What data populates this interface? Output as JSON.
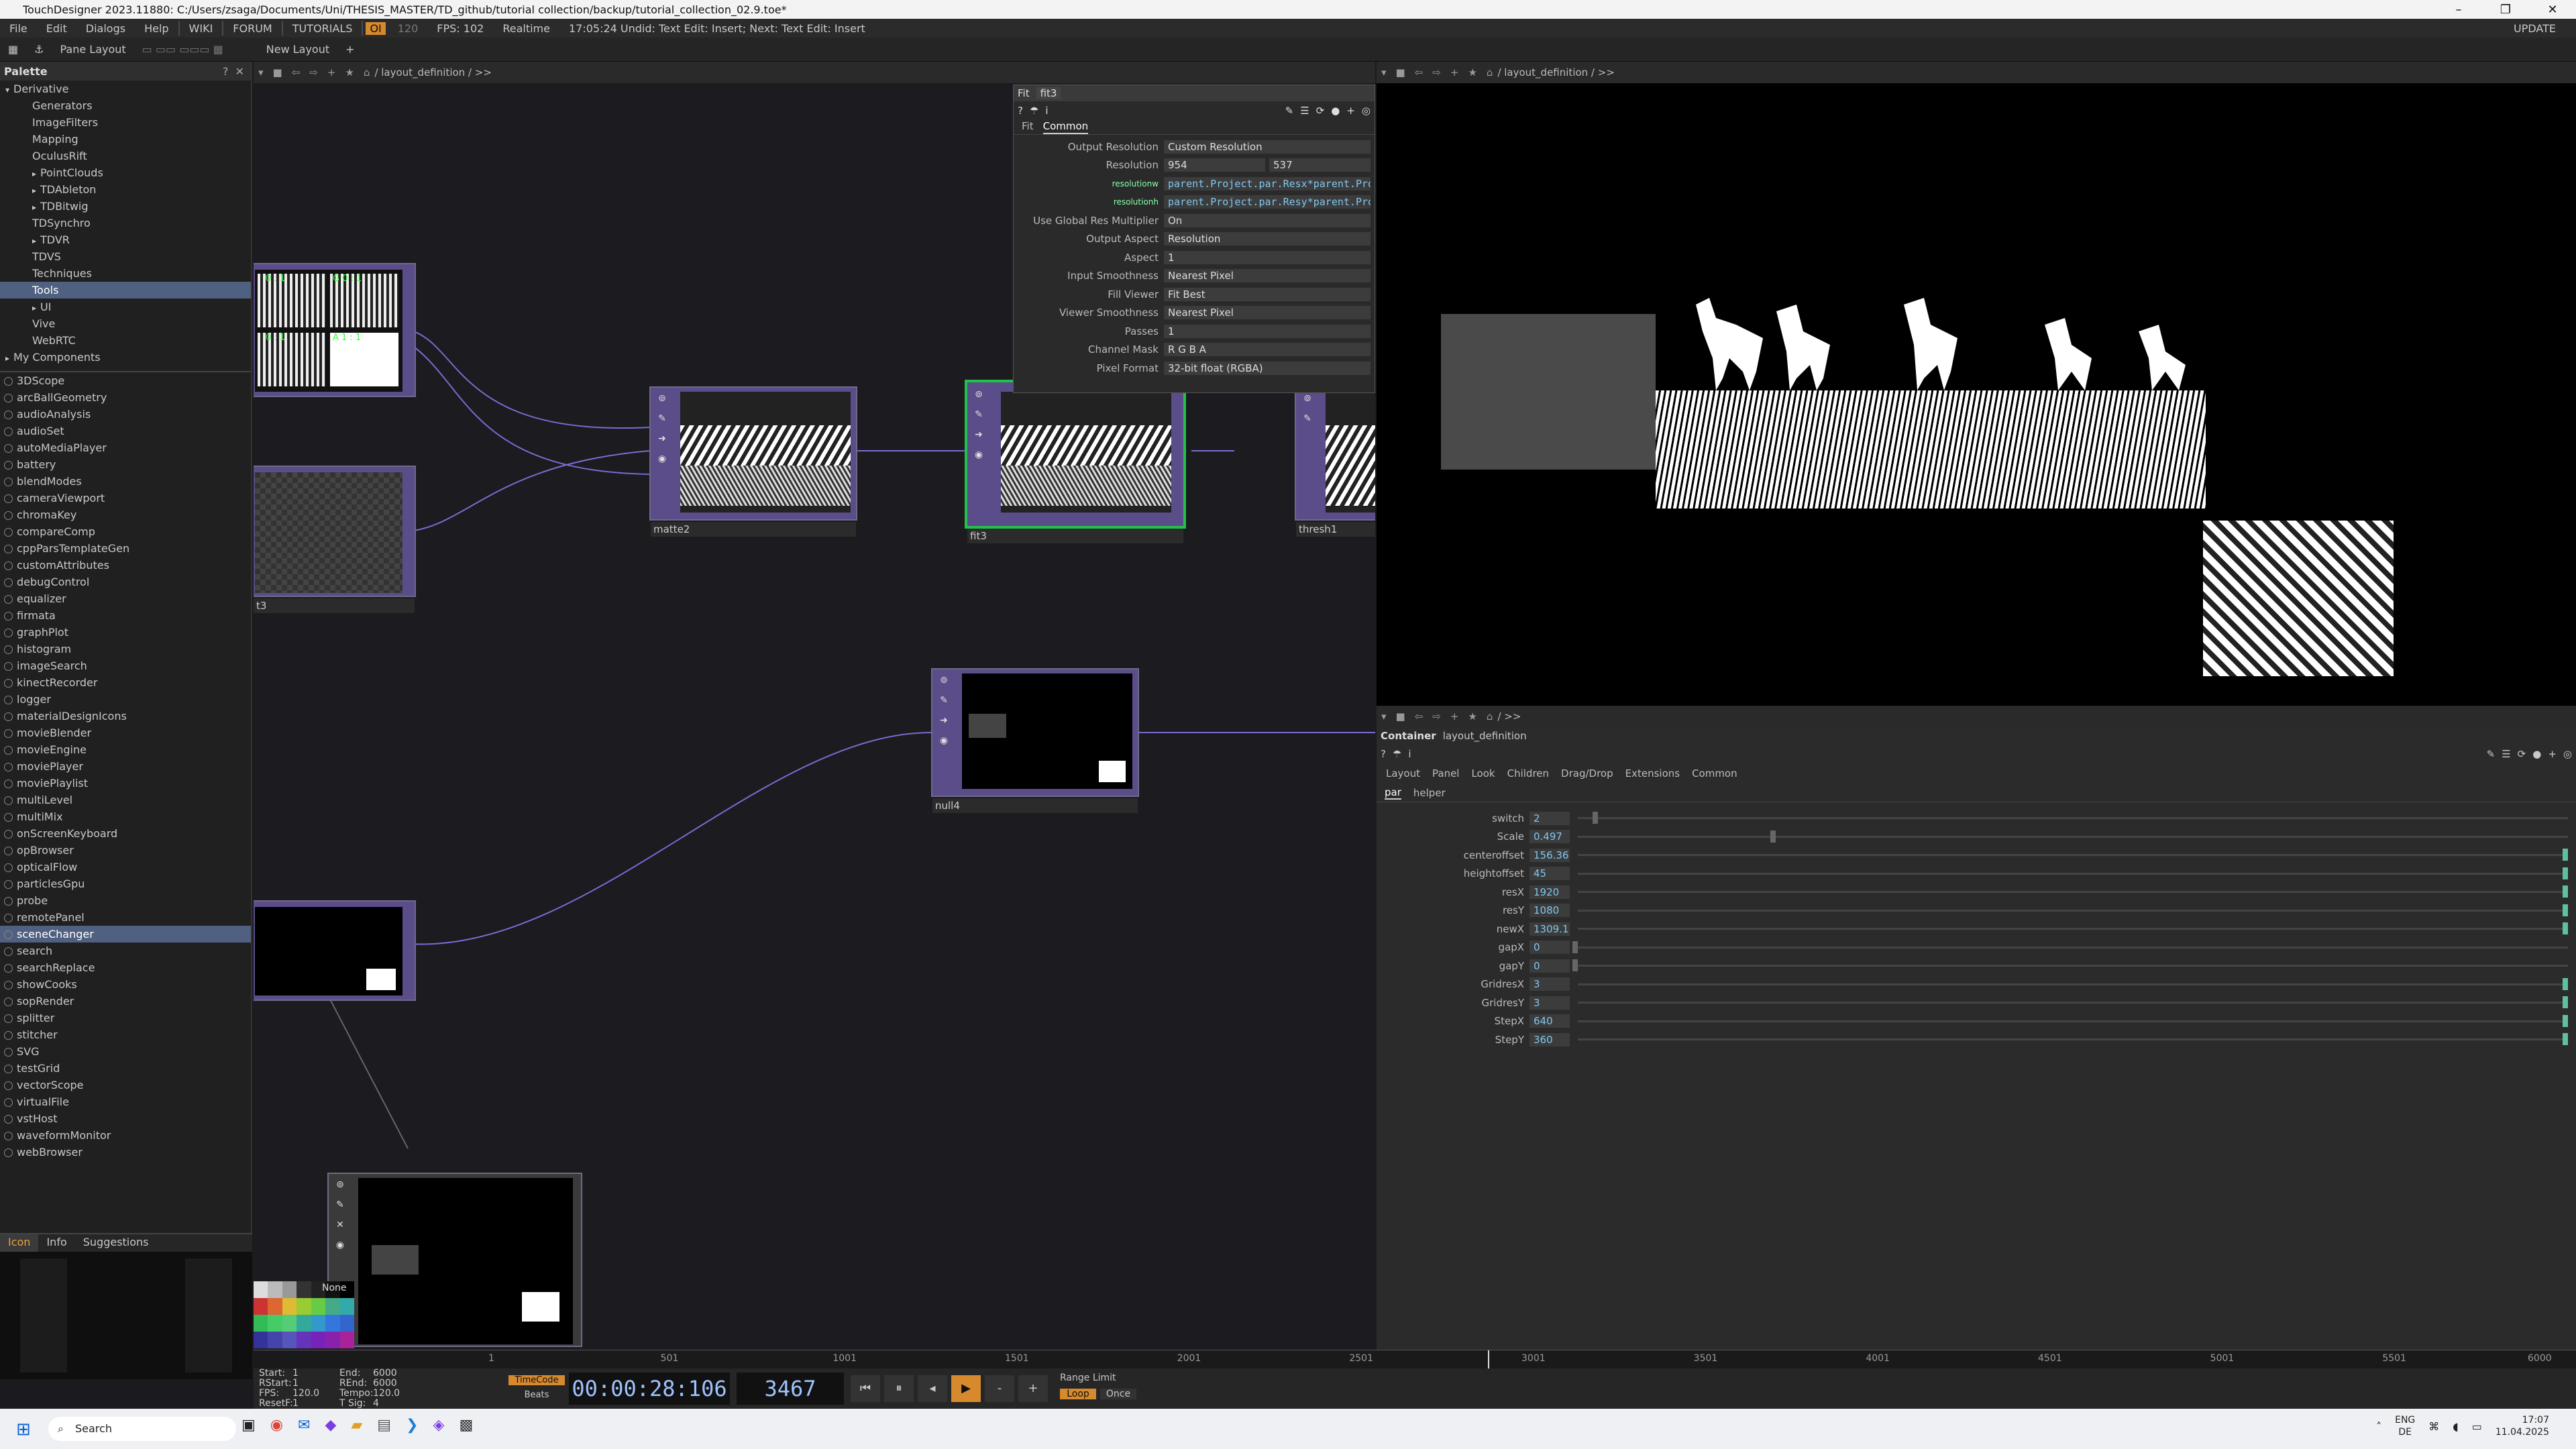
{
  "window": {
    "title": "TouchDesigner 2023.11880: C:/Users/zsaga/Documents/Uni/THESIS_MASTER/TD_github/tutorial collection/backup/tutorial_collection_02.9.toe*"
  },
  "menu": {
    "items": [
      "File",
      "Edit",
      "Dialogs",
      "Help"
    ],
    "links": [
      "WIKI",
      "FORUM",
      "TUTORIALS"
    ],
    "perf_badge": "OI",
    "fps_cap": "120",
    "fps": "FPS: 102",
    "realtime": "Realtime",
    "status": "17:05:24 Undid: Text Edit: Insert; Next: Text Edit: Insert",
    "update": "UPDATE"
  },
  "toolbar": {
    "pane_layout": "Pane Layout",
    "new_layout": "New Layout"
  },
  "net_path": "/ layout_definition / >>",
  "viewer_path": "/ layout_definition / >>",
  "ctrl_path": "/ >>",
  "palette": {
    "title": "Palette",
    "tree": [
      {
        "label": "Derivative",
        "indent": 0,
        "exp": "▾"
      },
      {
        "label": "Generators",
        "indent": 1
      },
      {
        "label": "ImageFilters",
        "indent": 1
      },
      {
        "label": "Mapping",
        "indent": 1
      },
      {
        "label": "OculusRift",
        "indent": 1
      },
      {
        "label": "PointClouds",
        "indent": 1,
        "exp": "▸"
      },
      {
        "label": "TDAbleton",
        "indent": 1,
        "exp": "▸"
      },
      {
        "label": "TDBitwig",
        "indent": 1,
        "exp": "▸"
      },
      {
        "label": "TDSynchro",
        "indent": 1
      },
      {
        "label": "TDVR",
        "indent": 1,
        "exp": "▸"
      },
      {
        "label": "TDVS",
        "indent": 1
      },
      {
        "label": "Techniques",
        "indent": 1
      },
      {
        "label": "Tools",
        "indent": 1,
        "selected": true
      },
      {
        "label": "UI",
        "indent": 1,
        "exp": "▸"
      },
      {
        "label": "Vive",
        "indent": 1
      },
      {
        "label": "WebRTC",
        "indent": 1
      },
      {
        "label": "My Components",
        "indent": 0,
        "exp": "▸"
      }
    ],
    "components": [
      "3DScope",
      "arcBallGeometry",
      "audioAnalysis",
      "audioSet",
      "autoMediaPlayer",
      "battery",
      "blendModes",
      "cameraViewport",
      "chromaKey",
      "compareComp",
      "cppParsTemplateGen",
      "customAttributes",
      "debugControl",
      "equalizer",
      "firmata",
      "graphPlot",
      "histogram",
      "imageSearch",
      "kinectRecorder",
      "logger",
      "materialDesignIcons",
      "movieBlender",
      "movieEngine",
      "moviePlayer",
      "moviePlaylist",
      "multiLevel",
      "multiMix",
      "onScreenKeyboard",
      "opBrowser",
      "opticalFlow",
      "particlesGpu",
      "probe",
      "remotePanel",
      "sceneChanger",
      "search",
      "searchReplace",
      "showCooks",
      "sopRender",
      "splitter",
      "stitcher",
      "SVG",
      "testGrid",
      "vectorScope",
      "virtualFile",
      "vstHost",
      "waveformMonitor",
      "webBrowser"
    ],
    "selected_component": "sceneChanger",
    "tabs": [
      "Icon",
      "Info",
      "Suggestions"
    ]
  },
  "nodes": {
    "matte": "matte2",
    "fit": "fit3",
    "thresh": "thresh1",
    "null": "null4",
    "t3": "t3",
    "cells": [
      "0 : 1",
      "G 0 : 1",
      "0 : 1",
      "A 1 : 1"
    ]
  },
  "fit_params": {
    "type": "Fit",
    "name": "fit3",
    "tabs": [
      "Fit",
      "Common"
    ],
    "rows": [
      {
        "label": "Output Resolution",
        "value": "Custom Resolution"
      },
      {
        "label": "Resolution",
        "value": "954",
        "value2": "537"
      },
      {
        "label": "resolutionw",
        "value": "parent.Project.par.Resx*parent.Proje",
        "expr": true
      },
      {
        "label": "resolutionh",
        "value": "parent.Project.par.Resy*parent.Proje",
        "expr": true
      },
      {
        "label": "Use Global Res Multiplier",
        "value": "On"
      },
      {
        "label": "Output Aspect",
        "value": "Resolution"
      },
      {
        "label": "Aspect",
        "value": "1"
      },
      {
        "label": "Input Smoothness",
        "value": "Nearest Pixel"
      },
      {
        "label": "Fill Viewer",
        "value": "Fit Best"
      },
      {
        "label": "Viewer Smoothness",
        "value": "Nearest Pixel"
      },
      {
        "label": "Passes",
        "value": "1"
      },
      {
        "label": "Channel Mask",
        "value": "R  G  B  A"
      },
      {
        "label": "Pixel Format",
        "value": "32-bit float (RGBA)"
      }
    ]
  },
  "container": {
    "type": "Container",
    "name": "layout_definition",
    "tabs": [
      "Layout",
      "Panel",
      "Look",
      "Children",
      "Drag/Drop",
      "Extensions",
      "Common"
    ],
    "subtabs": [
      "par",
      "helper"
    ],
    "params": [
      {
        "label": "switch",
        "value": "2",
        "level": 0.02
      },
      {
        "label": "Scale",
        "value": "0.497",
        "level": 0.2
      },
      {
        "label": "centeroffset",
        "value": "156.36",
        "level": 1
      },
      {
        "label": "heightoffset",
        "value": "45",
        "level": 1
      },
      {
        "label": "resX",
        "value": "1920",
        "level": 1
      },
      {
        "label": "resY",
        "value": "1080",
        "level": 1
      },
      {
        "label": "newX",
        "value": "1309.1",
        "level": 1
      },
      {
        "label": "gapX",
        "value": "0",
        "level": 0
      },
      {
        "label": "gapY",
        "value": "0",
        "level": 0
      },
      {
        "label": "GridresX",
        "value": "3",
        "level": 1
      },
      {
        "label": "GridresY",
        "value": "3",
        "level": 1
      },
      {
        "label": "StepX",
        "value": "640",
        "level": 1
      },
      {
        "label": "StepY",
        "value": "360",
        "level": 1
      }
    ]
  },
  "timeline": {
    "ticks": [
      "1",
      "501",
      "1001",
      "1501",
      "2001",
      "2501",
      "3001",
      "3501",
      "4001",
      "4501",
      "5001",
      "5501",
      "6000"
    ]
  },
  "transport": {
    "start": "1",
    "rstart": "1",
    "fps": "120.0",
    "resetf": "1",
    "end": "6000",
    "rend": "6000",
    "tempo": "120.0",
    "tsig": "4",
    "timecode_label": "TimeCode",
    "beats_label": "Beats",
    "timecode": "00:00:28:106",
    "frame": "3467",
    "range_limit": "Range Limit",
    "loop": "Loop",
    "once": "Once",
    "none": "None"
  },
  "taskbar": {
    "search": "Search",
    "lang": "ENG",
    "region": "DE",
    "time": "17:07",
    "date": "11.04.2025"
  },
  "colors": {
    "accent": "#d7892d",
    "node": "#5b4c8a",
    "selected_node": "#22c24a",
    "expr": "#7fc7f0"
  }
}
